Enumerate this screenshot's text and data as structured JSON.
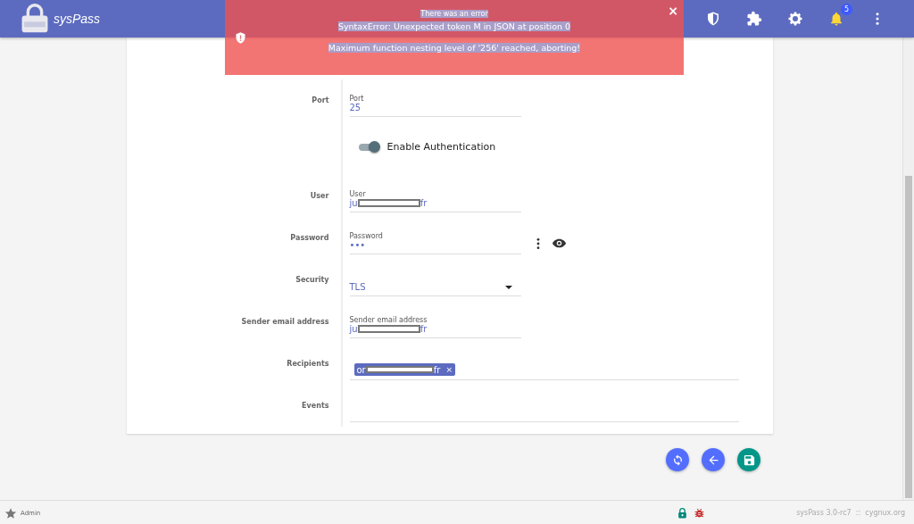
{
  "header": {
    "logo_title": "sysPass",
    "notification_count": "5"
  },
  "error_toast": {
    "title": "There was an error",
    "lines": [
      "SyntaxError: Unexpected token M in JSON at position 0",
      "Maximum function nesting level of '256' reached, aborting!"
    ],
    "close": "×"
  },
  "form": {
    "rows": [
      {
        "kind": "text",
        "label": "Port",
        "field_label": "Port",
        "value_start": "25"
      },
      {
        "kind": "switch",
        "switch_label": "Enable Authentication",
        "on": true
      },
      {
        "kind": "text",
        "label": "User",
        "field_label": "User",
        "value_start": "ju",
        "value_end": "fr"
      },
      {
        "kind": "password",
        "label": "Password",
        "field_label": "Password",
        "value_start": "•••"
      },
      {
        "kind": "select",
        "label": "Security",
        "value_start": "TLS"
      },
      {
        "kind": "text",
        "label": "Sender email address",
        "field_label": "Sender email address",
        "value_start": "ju",
        "value_end": "fr"
      },
      {
        "kind": "chips",
        "label": "Recipients",
        "chips": [
          {
            "start": "or",
            "end": "fr",
            "remove": "×"
          }
        ]
      },
      {
        "kind": "chips",
        "label": "Events",
        "chips": []
      }
    ]
  },
  "footer": {
    "user": "Admin",
    "version": "sysPass 3.0-rc7  ::  cygnux.org"
  }
}
